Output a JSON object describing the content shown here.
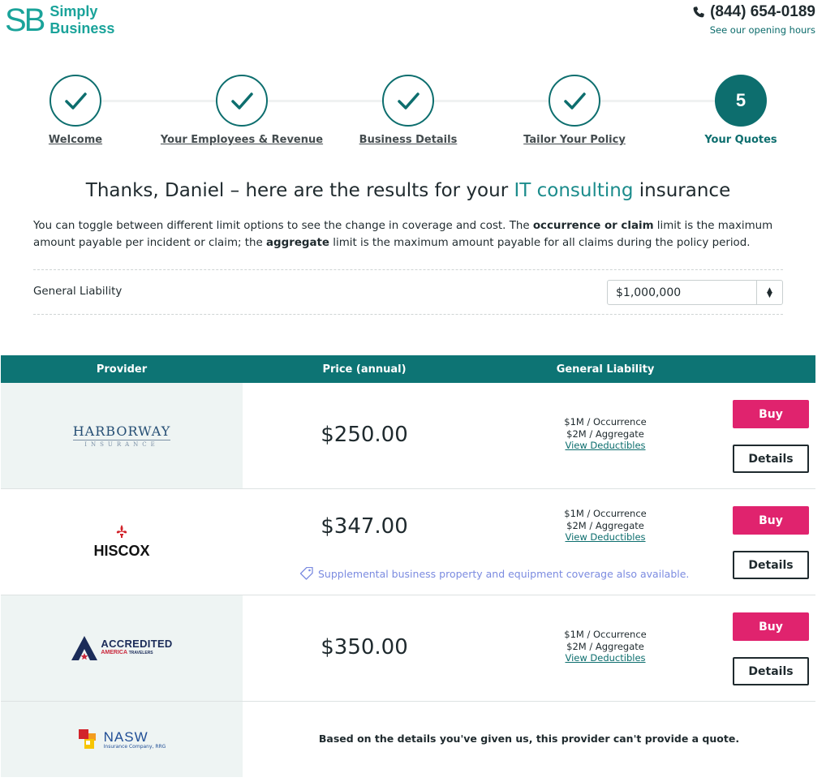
{
  "brand": {
    "mark": "SB",
    "name_line1": "Simply",
    "name_line2": "Business",
    "color": "#1aa39a"
  },
  "contact": {
    "phone": "(844) 654-0189",
    "hours_link": "See our opening hours",
    "phone_icon": "phone-icon"
  },
  "stepper": {
    "steps": [
      {
        "label": "Welcome",
        "state": "complete"
      },
      {
        "label": "Your Employees & Revenue",
        "state": "complete"
      },
      {
        "label": "Business Details",
        "state": "complete"
      },
      {
        "label": "Tailor Your Policy",
        "state": "complete"
      },
      {
        "label": "Your Quotes",
        "state": "active",
        "number": "5"
      }
    ]
  },
  "heading": {
    "prefix": "Thanks, Daniel – here are the results for your ",
    "highlight": "IT consulting",
    "suffix": " insurance"
  },
  "intro": {
    "part1": "You can toggle between different limit options to see the change in coverage and cost. The ",
    "bold1": "occurrence or claim",
    "part2": " limit is the maximum amount payable per incident or claim; the ",
    "bold2": "aggregate",
    "part3": " limit is the maximum amount payable for all claims during the policy period."
  },
  "limit": {
    "label": "General Liability",
    "selected": "$1,000,000"
  },
  "table": {
    "headers": {
      "provider": "Provider",
      "price": "Price (annual)",
      "coverage": "General Liability"
    },
    "quotes": [
      {
        "provider": "HARBORWAY",
        "provider_sub": "INSURANCE",
        "price": "$250.00",
        "occurrence": "$1M / Occurrence",
        "aggregate": "$2M / Aggregate",
        "deductibles_link": "View Deductibles",
        "buy_label": "Buy",
        "details_label": "Details"
      },
      {
        "provider": "HISCOX",
        "price": "$347.00",
        "occurrence": "$1M / Occurrence",
        "aggregate": "$2M / Aggregate",
        "deductibles_link": "View Deductibles",
        "buy_label": "Buy",
        "details_label": "Details",
        "promo": "Supplemental business property and equipment coverage also available."
      },
      {
        "provider": "ACCREDITED",
        "provider_sub": "AMERICA",
        "provider_sub2": "TRAVELERS",
        "price": "$350.00",
        "occurrence": "$1M / Occurrence",
        "aggregate": "$2M / Aggregate",
        "deductibles_link": "View Deductibles",
        "buy_label": "Buy",
        "details_label": "Details"
      },
      {
        "provider": "NASW",
        "provider_sub": "Insurance Company, RRG",
        "message": "Based on the details you've given us, this provider can't provide a quote."
      }
    ]
  },
  "colors": {
    "teal": "#0d7474",
    "buy": "#e0236e",
    "promo": "#7b8be0",
    "provider_bg": "#eef4f3"
  }
}
